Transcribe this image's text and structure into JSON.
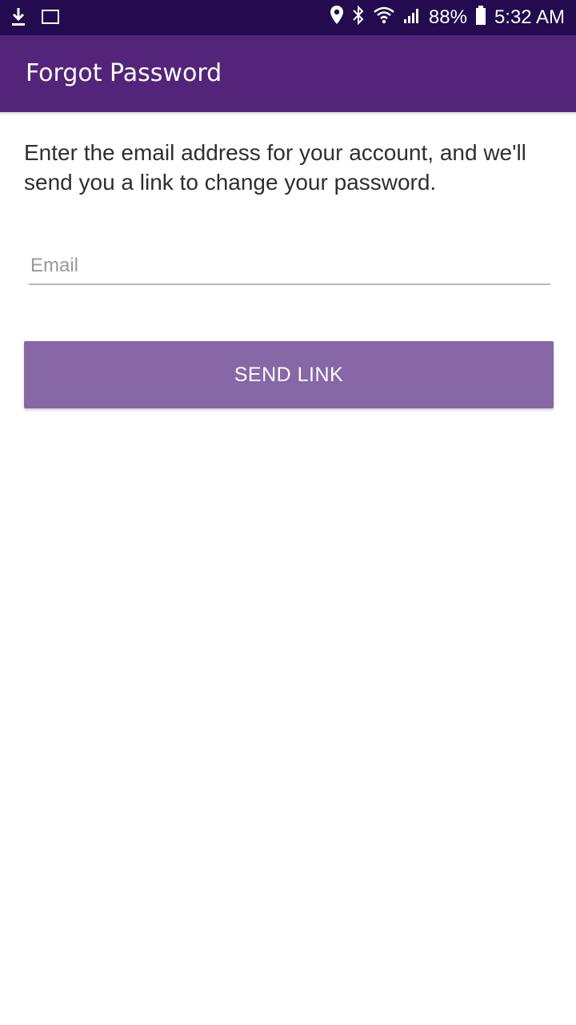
{
  "status_bar": {
    "battery": "88%",
    "time": "5:32 AM",
    "left_icons": [
      "download-icon",
      "screenshot-icon"
    ],
    "right_icons": [
      "location-icon",
      "bluetooth-icon",
      "wifi-icon",
      "signal-icon",
      "battery-icon"
    ]
  },
  "app_bar": {
    "title": "Forgot Password"
  },
  "main": {
    "instruction": "Enter the email address for your account, and we'll send you a link to change your password.",
    "email": {
      "value": "",
      "placeholder": "Email"
    },
    "send_button_label": "SEND LINK"
  },
  "colors": {
    "status_bar": "#240b4f",
    "app_bar": "#54247a",
    "button": "#8767a6"
  }
}
